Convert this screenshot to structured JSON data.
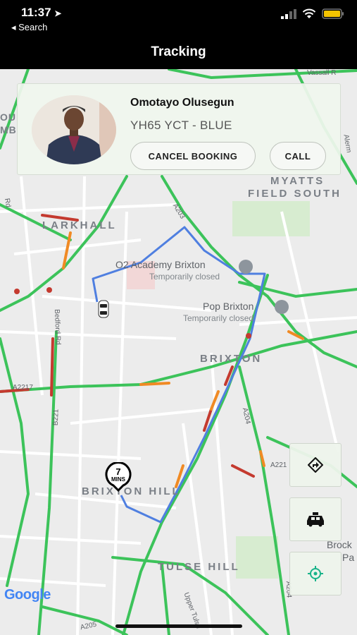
{
  "status_bar": {
    "time": "11:37",
    "back_label": "◂ Search"
  },
  "nav": {
    "title": "Tracking"
  },
  "driver": {
    "name": "Omotayo Olusegun",
    "vehicle": "YH65 YCT -  BLUE",
    "cancel_label": "CANCEL BOOKING",
    "call_label": "CALL"
  },
  "map": {
    "areas": {
      "larkhall": "LARKHALL",
      "myatts": "MYATTS",
      "field_south": "FIELD SOUTH",
      "brixton": "BRIXTON",
      "brixton_hill": "BRIXTON HILL",
      "tulse_hill": "TULSE HILL",
      "brock": "Brock",
      "pa": "Pa",
      "ou": "OU",
      "mb": "MB"
    },
    "pois": {
      "o2_name": "O2 Academy Brixton",
      "o2_status": "Temporarily closed",
      "pop_name": "Pop Brixton",
      "pop_status": "Temporarily closed"
    },
    "roads": {
      "a203": "A203",
      "a204": "A204",
      "a204_south": "A204",
      "a2217": "A2217",
      "a221": "A221",
      "a205": "A205",
      "b221": "B221",
      "bedford": "Bedford Rd",
      "vassall": "Vassall R",
      "upper_tulse": "Upper Tulse",
      "alerm": "Alerm",
      "rd": "Rd"
    },
    "google": "Google"
  },
  "eta": {
    "value": "7",
    "unit": "MINS"
  },
  "controls": {
    "route_icon": "directions-icon",
    "taxi_icon": "taxi-icon",
    "locate_icon": "crosshair-icon"
  }
}
